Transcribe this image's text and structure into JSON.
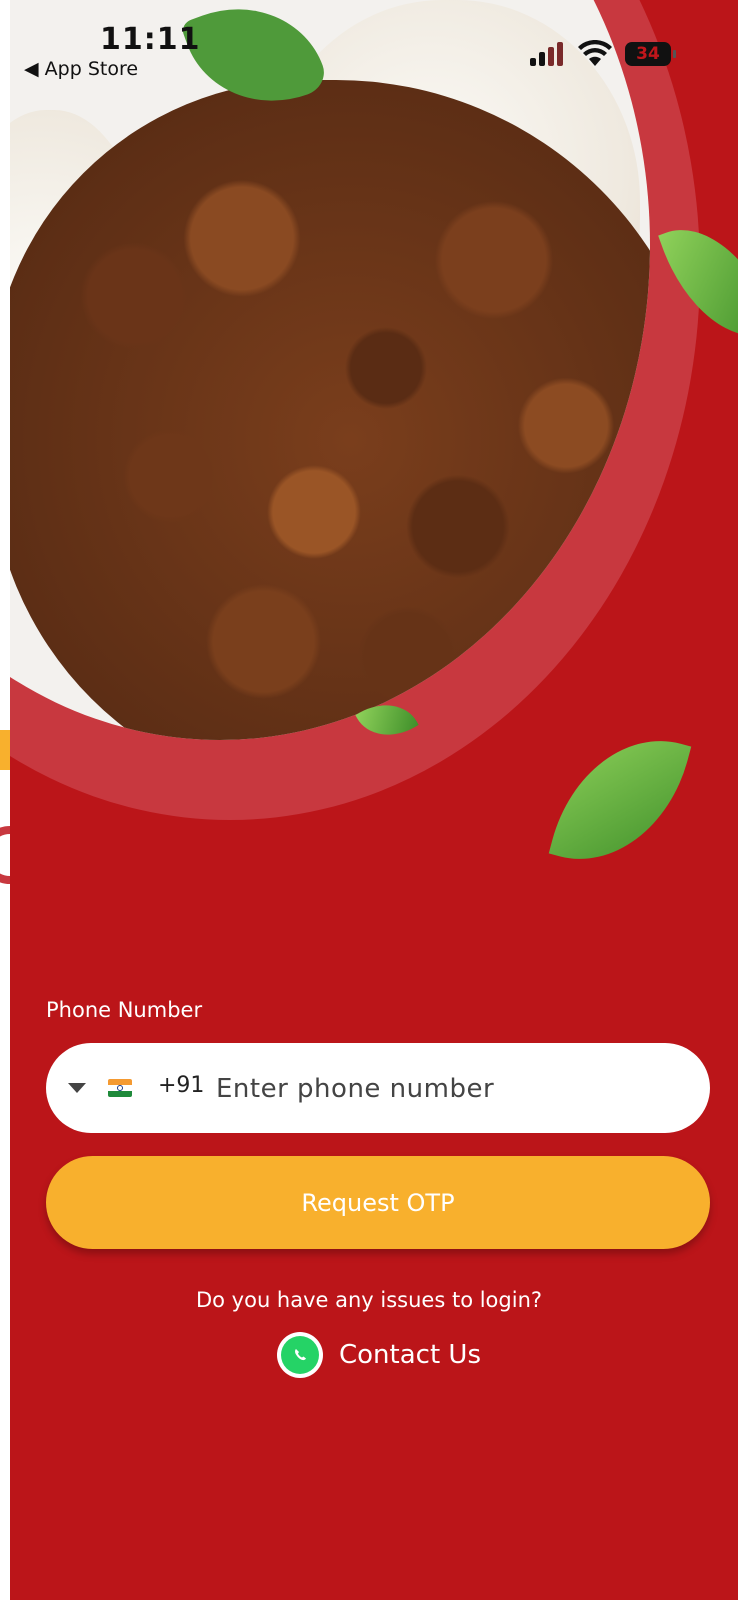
{
  "status_bar": {
    "time": "11:11",
    "back_label": "App Store",
    "battery": "34"
  },
  "hero": {
    "image_alt": "Chana curry with puttu"
  },
  "login": {
    "phone_label": "Phone Number",
    "country_code": "+91",
    "phone_placeholder": "Enter phone number",
    "phone_value": "",
    "request_otp_label": "Request OTP",
    "issue_text": "Do you have any issues to login?",
    "contact_label": "Contact Us"
  },
  "colors": {
    "background": "#bb1519",
    "accent_button": "#f8b02d",
    "input_background": "#ffffff",
    "whatsapp": "#25d366"
  },
  "icons": {
    "dropdown": "chevron-down-icon",
    "flag": "india-flag-icon",
    "contact": "whatsapp-icon"
  }
}
